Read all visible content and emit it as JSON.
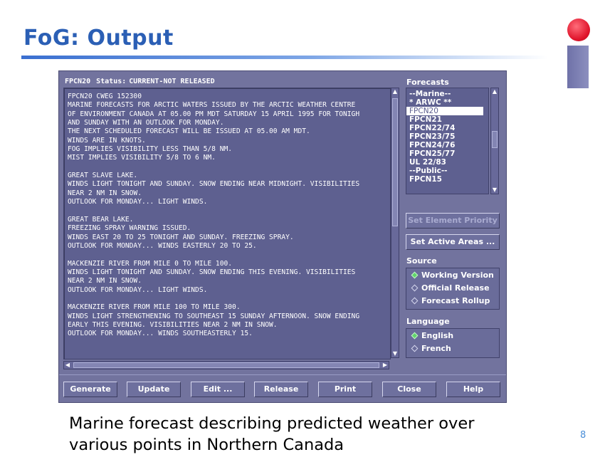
{
  "slide": {
    "title": "FoG: Output",
    "caption_line1": "Marine forecast describing predicted weather over",
    "caption_line2": "various points in Northern Canada",
    "page_number": "8"
  },
  "window": {
    "product_id": "FPCN20",
    "status_label": "Status:",
    "status_value": "CURRENT-NOT RELEASED",
    "forecast_text": "FPCN20 CWEG 152300\nMARINE FORECASTS FOR ARCTIC WATERS ISSUED BY THE ARCTIC WEATHER CENTRE\nOF ENVIRONMENT CANADA AT 05.00 PM MDT SATURDAY 15 APRIL 1995 FOR TONIGH\nAND SUNDAY WITH AN OUTLOOK FOR MONDAY.\nTHE NEXT SCHEDULED FORECAST WILL BE ISSUED AT 05.00 AM MDT.\nWINDS ARE IN KNOTS.\nFOG IMPLIES VISIBILITY LESS THAN 5/8 NM.\nMIST IMPLIES VISIBILITY 5/8 TO 6 NM.\n\nGREAT SLAVE LAKE.\nWINDS LIGHT TONIGHT AND SUNDAY. SNOW ENDING NEAR MIDNIGHT. VISIBILITIES\nNEAR 2 NM IN SNOW.\nOUTLOOK FOR MONDAY... LIGHT WINDS.\n\nGREAT BEAR LAKE.\nFREEZING SPRAY WARNING ISSUED.\nWINDS EAST 20 TO 25 TONIGHT AND SUNDAY. FREEZING SPRAY.\nOUTLOOK FOR MONDAY... WINDS EASTERLY 20 TO 25.\n\nMACKENZIE RIVER FROM MILE 0 TO MILE 100.\nWINDS LIGHT TONIGHT AND SUNDAY. SNOW ENDING THIS EVENING. VISIBILITIES\nNEAR 2 NM IN SNOW.\nOUTLOOK FOR MONDAY... LIGHT WINDS.\n\nMACKENZIE RIVER FROM MILE 100 TO MILE 300.\nWINDS LIGHT STRENGTHENING TO SOUTHEAST 15 SUNDAY AFTERNOON. SNOW ENDING\nEARLY THIS EVENING. VISIBILITIES NEAR 2 NM IN SNOW.\nOUTLOOK FOR MONDAY... WINDS SOUTHEASTERLY 15."
  },
  "forecasts": {
    "label": "Forecasts",
    "items": [
      "--Marine--",
      "* ARWC **",
      "FPCN20",
      "FPCN21",
      "FPCN22/74",
      "FPCN23/75",
      "FPCN24/76",
      "FPCN25/77",
      "UL 22/83",
      "--Public--",
      "FPCN15"
    ],
    "selected": "FPCN20"
  },
  "side_buttons": {
    "set_element_priority": "Set Element Priority ...",
    "set_active_areas": "Set Active Areas ..."
  },
  "source": {
    "label": "Source",
    "options": [
      "Working Version",
      "Official Release",
      "Forecast Rollup"
    ],
    "selected": "Working Version"
  },
  "language": {
    "label": "Language",
    "options": [
      "English",
      "French"
    ],
    "selected": "English"
  },
  "bottom_buttons": [
    "Generate",
    "Update",
    "Edit ...",
    "Release",
    "Print",
    "Close",
    "Help"
  ],
  "colors": {
    "title": "#2b5fb5",
    "window_bg": "#72739e",
    "text_area_bg": "#5e6090",
    "radio_selected": "#5fd46a",
    "logo_dot": "#e0142b",
    "page_number": "#4a8ed8"
  }
}
